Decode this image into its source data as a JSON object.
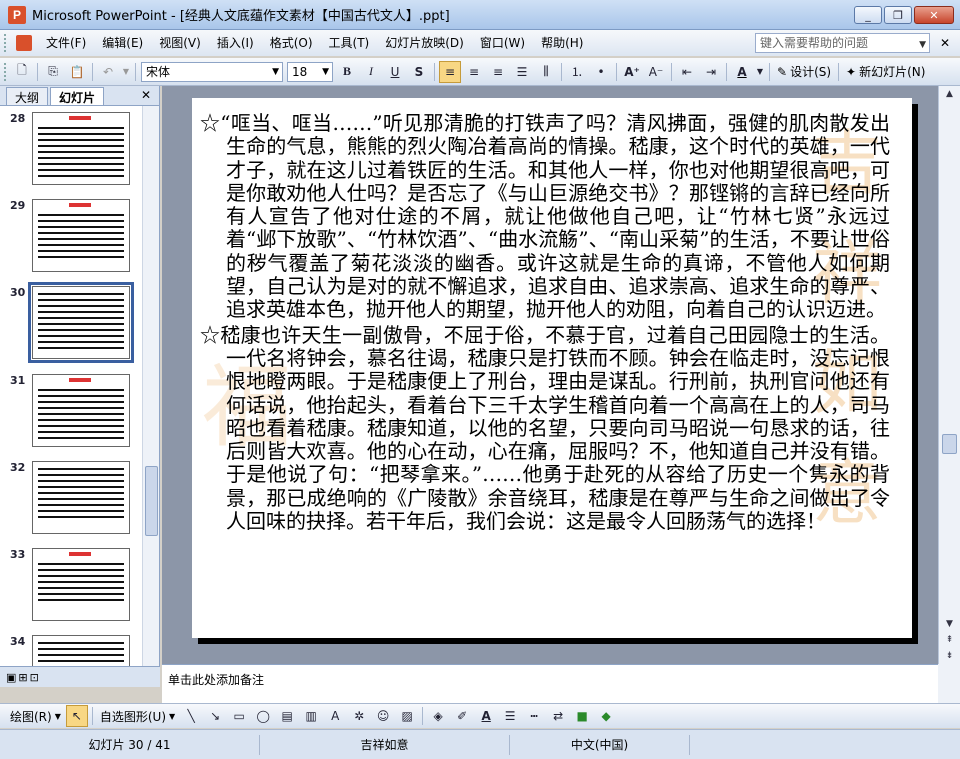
{
  "window": {
    "title": "Microsoft PowerPoint - [经典人文底蕴作文素材【中国古代文人】.ppt]",
    "buttons": [
      "_",
      "❐",
      "✕"
    ]
  },
  "menu": {
    "items": [
      "文件(F)",
      "编辑(E)",
      "视图(V)",
      "插入(I)",
      "格式(O)",
      "工具(T)",
      "幻灯片放映(D)",
      "窗口(W)",
      "帮助(H)"
    ],
    "help_placeholder": "键入需要帮助的问题"
  },
  "toolbar": {
    "font_name": "宋体",
    "font_size": "18",
    "design_label": "设计(S)",
    "new_slide_label": "新幻灯片(N)"
  },
  "pane": {
    "tabs": [
      "大纲",
      "幻灯片"
    ],
    "active_tab": "幻灯片",
    "thumbnails": [
      {
        "num": "28",
        "selected": false
      },
      {
        "num": "29",
        "selected": false
      },
      {
        "num": "30",
        "selected": true
      },
      {
        "num": "31",
        "selected": false
      },
      {
        "num": "32",
        "selected": false
      },
      {
        "num": "33",
        "selected": false
      },
      {
        "num": "34",
        "selected": false
      }
    ]
  },
  "slide": {
    "paragraphs": [
      "☆“哐当、哐当……”听见那清脆的打铁声了吗？清风拂面，强健的肌肉散发出生命的气息，熊熊的烈火陶冶着高尚的情操。嵇康，这个时代的英雄，一代才子，就在这儿过着铁匠的生活。和其他人一样，你也对他期望很高吧，可是你敢劝他人仕吗？是否忘了《与山巨源绝交书》？那铿锵的言辞已经向所有人宣告了他对仕途的不屑，就让他做他自己吧，让“竹林七贤”永远过着“邺下放歌”、“竹林饮酒”、“曲水流觞”、“南山采菊”的生活，不要让世俗的秽气覆盖了菊花淡淡的幽香。或许这就是生命的真谛，不管他人如何期望，自己认为是对的就不懈追求，追求自由、追求崇高、追求生命的尊严、追求英雄本色，抛开他人的期望，抛开他人的劝阻，向着自己的认识迈进。",
      "☆嵇康也许天生一副傲骨，不屈于俗，不慕于官，过着自己田园隐士的生活。一代名将钟会，慕名往谒，嵇康只是打铁而不顾。钟会在临走时，没忘记恨恨地瞪两眼。于是嵇康便上了刑台，理由是谋乱。行刑前，执刑官问他还有何话说，他抬起头，看着台下三千太学生稽首向着一个高高在上的人，司马昭也看着嵇康。嵇康知道，以他的名望，只要向司马昭说一句恳求的话，往后则皆大欢喜。他的心在动，心在痛，屈服吗？不，他知道自己并没有错。于是他说了句：“把琴拿来。”……他勇于赴死的从容给了历史一个隽永的背景，那已成绝响的《广陵散》余音绕耳，嵇康是在尊严与生命之间做出了令人回味的抉择。若干年后，我们会说：这是最令人回肠荡气的选择！"
    ]
  },
  "notes": {
    "placeholder": "单击此处添加备注"
  },
  "drawbar": {
    "draw_label": "绘图(R)",
    "autoshapes_label": "自选图形(U)"
  },
  "status": {
    "slide_info": "幻灯片 30 / 41",
    "design": "吉祥如意",
    "language": "中文(中国)"
  }
}
